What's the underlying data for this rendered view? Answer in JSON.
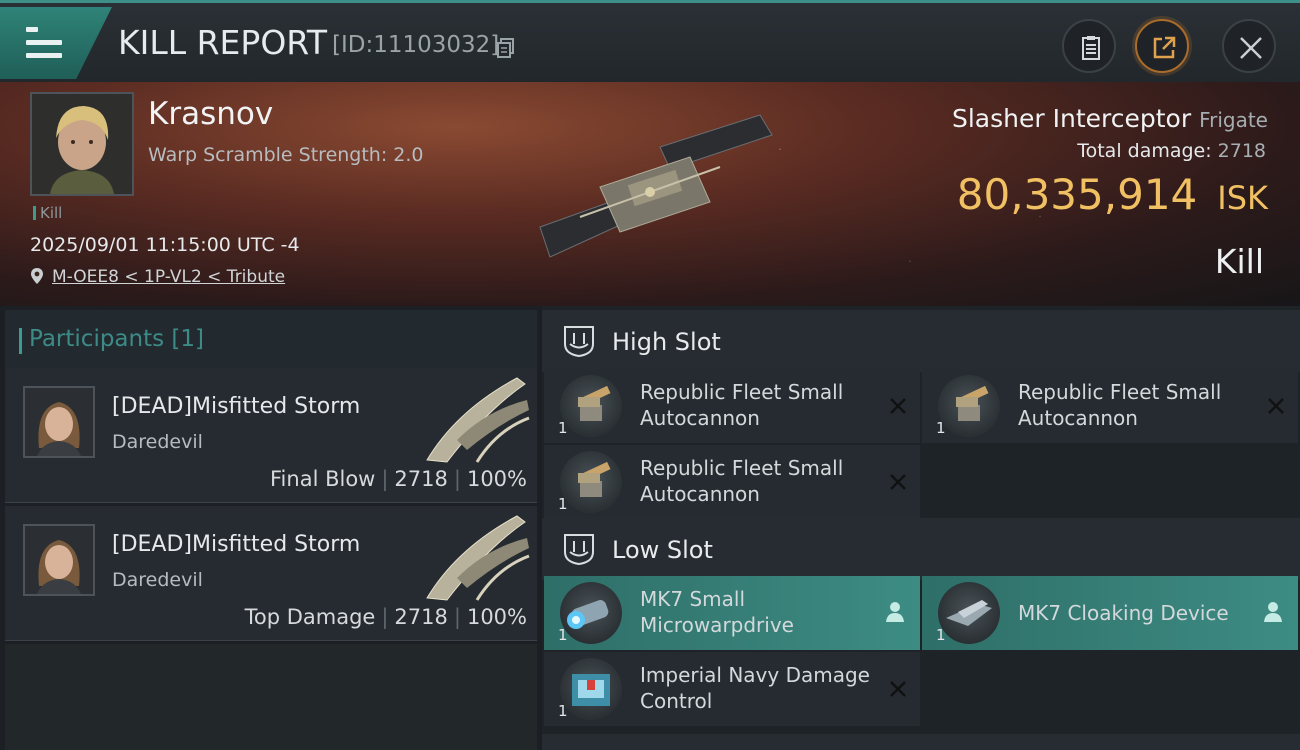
{
  "header": {
    "title": "KILL REPORT",
    "report_id": "[ID:11103032]"
  },
  "victim": {
    "pilot_name": "Krasnov",
    "scramble_text": "Warp Scramble Strength: 2.0",
    "tag": "Kill",
    "datetime": "2025/09/01 11:15:00 UTC -4",
    "location": "M-OEE8 < 1P-VL2 < Tribute",
    "ship_name": "Slasher Interceptor",
    "ship_class": "Frigate",
    "total_damage_label": "Total damage:",
    "total_damage_value": "2718",
    "isk_value": "80,335,914",
    "isk_unit": "ISK",
    "result": "Kill"
  },
  "participants": {
    "header": "Participants [1]",
    "rows": [
      {
        "name": "[DEAD]Misfitted Storm",
        "ship": "Daredevil",
        "label": "Final Blow",
        "damage": "2718",
        "percent": "100%"
      },
      {
        "name": "[DEAD]Misfitted Storm",
        "ship": "Daredevil",
        "label": "Top Damage",
        "damage": "2718",
        "percent": "100%"
      }
    ]
  },
  "slots": {
    "high": {
      "title": "High Slot",
      "modules": [
        {
          "name": "Republic Fleet Small Autocannon",
          "qty": "1",
          "state": "destroyed"
        },
        {
          "name": "Republic Fleet Small Autocannon",
          "qty": "1",
          "state": "destroyed"
        },
        {
          "name": "Republic Fleet Small Autocannon",
          "qty": "1",
          "state": "destroyed"
        }
      ]
    },
    "low": {
      "title": "Low Slot",
      "modules": [
        {
          "name": "MK7 Small Microwarpdrive",
          "qty": "1",
          "state": "dropped"
        },
        {
          "name": "MK7 Cloaking Device",
          "qty": "1",
          "state": "dropped"
        },
        {
          "name": "Imperial Navy Damage Control",
          "qty": "1",
          "state": "destroyed"
        }
      ]
    }
  },
  "colors": {
    "accent": "#3e8f87",
    "isk": "#f1c063",
    "dropped_bg": "#3d8c84"
  },
  "icons": {
    "menu": "hamburger-icon",
    "copy": "copy-icon",
    "clipboard": "clipboard-icon",
    "share": "share-icon",
    "close": "close-icon",
    "location": "location-pin-icon",
    "slot": "slot-shield-icon",
    "destroyed": "x-icon",
    "dropped": "person-icon"
  }
}
